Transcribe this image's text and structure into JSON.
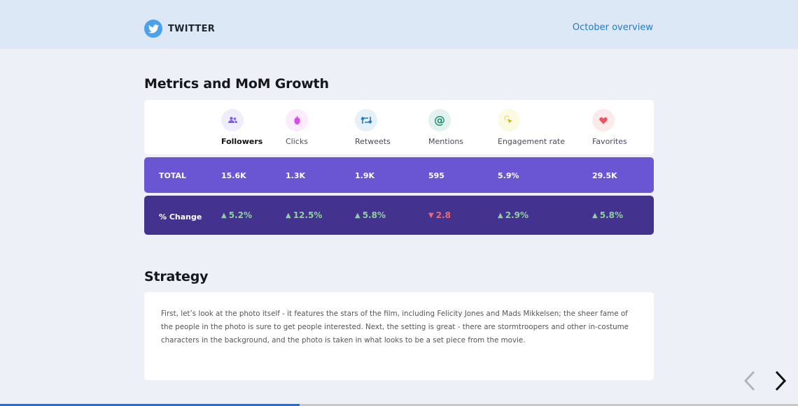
{
  "header": {
    "brand": "TWITTER",
    "overview_link": "October overview"
  },
  "metrics": {
    "title": "Metrics and MoM Growth",
    "columns": [
      {
        "label": "Followers",
        "icon": "followers-icon",
        "icon_color": "#7c5ce8",
        "icon_bg": "#efedfc",
        "total": "15.6K",
        "change": "5.2%",
        "direction": "up"
      },
      {
        "label": "Clicks",
        "icon": "mouse-icon",
        "icon_color": "#d64bf0",
        "icon_bg": "#fcebfd",
        "total": "1.3K",
        "change": "12.5%",
        "direction": "up"
      },
      {
        "label": "Retweets",
        "icon": "retweet-icon",
        "icon_color": "#2079b8",
        "icon_bg": "#e6f0f8",
        "total": "1.9K",
        "change": "5.8%",
        "direction": "up"
      },
      {
        "label": "Mentions",
        "icon": "at-icon",
        "icon_color": "#1a9171",
        "icon_bg": "#e3f2ee",
        "total": "595",
        "change": "2.8",
        "direction": "down"
      },
      {
        "label": "Engagement rate",
        "icon": "cursor-click-icon",
        "icon_color": "#c9b700",
        "icon_bg": "#fbfbe4",
        "total": "5.9%",
        "change": "2.9%",
        "direction": "up"
      },
      {
        "label": "Favorites",
        "icon": "heart-icon",
        "icon_color": "#f0525e",
        "icon_bg": "#fdeaea",
        "total": "29.5K",
        "change": "5.8%",
        "direction": "up"
      }
    ],
    "total_label": "TOTAL",
    "change_label": "% Change",
    "up_color": "#8fd19e",
    "down_color": "#f06a6a",
    "up_symbol": "▲",
    "down_symbol": "▼"
  },
  "strategy": {
    "title": "Strategy",
    "text": "First, let’s look at the photo itself - it features the stars of the film, including Felicity Jones and Mads Mikkelsen; the sheer fame of the people in the photo is sure to get people interested. Next, the setting is great - there are stormtroopers and other in-costume characters in the background, and the photo is taken in what looks to be a set piece from the movie."
  },
  "navigation": {
    "prev_icon": "chevron-left-icon",
    "next_icon": "chevron-right-icon",
    "progress": 0.375
  }
}
